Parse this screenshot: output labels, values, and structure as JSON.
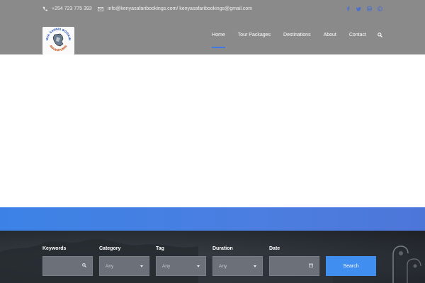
{
  "topbar": {
    "phone": "+254 723 775 393",
    "email": "info@kenyasafaribookings.com/ kenyasafaribookings@gmail.com",
    "phone_icon": "phone-icon",
    "email_icon": "envelope-icon",
    "socials": [
      "facebook-icon",
      "twitter-icon",
      "instagram-icon",
      "pinterest-icon"
    ]
  },
  "logo": {
    "text_top": "KENYA SAFARI BOOKINGS",
    "text_bottom": "ADVENTURES"
  },
  "nav": {
    "items": [
      {
        "label": "Home",
        "active": true
      },
      {
        "label": "Tour Packages",
        "active": false
      },
      {
        "label": "Destinations",
        "active": false
      },
      {
        "label": "About",
        "active": false
      },
      {
        "label": "Contact",
        "active": false
      }
    ],
    "search_icon": "search-icon"
  },
  "search_form": {
    "keywords_label": "Keywords",
    "keywords_value": "",
    "category_label": "Category",
    "category_value": "Any",
    "tag_label": "Tag",
    "tag_value": "Any",
    "duration_label": "Duration",
    "duration_value": "Any",
    "date_label": "Date",
    "date_value": "",
    "submit_label": "Search"
  },
  "colors": {
    "header_bg": "#8a8a8a",
    "accent": "#3f79e6",
    "band": "#4b7ee0",
    "button": "#3f8ef0"
  }
}
